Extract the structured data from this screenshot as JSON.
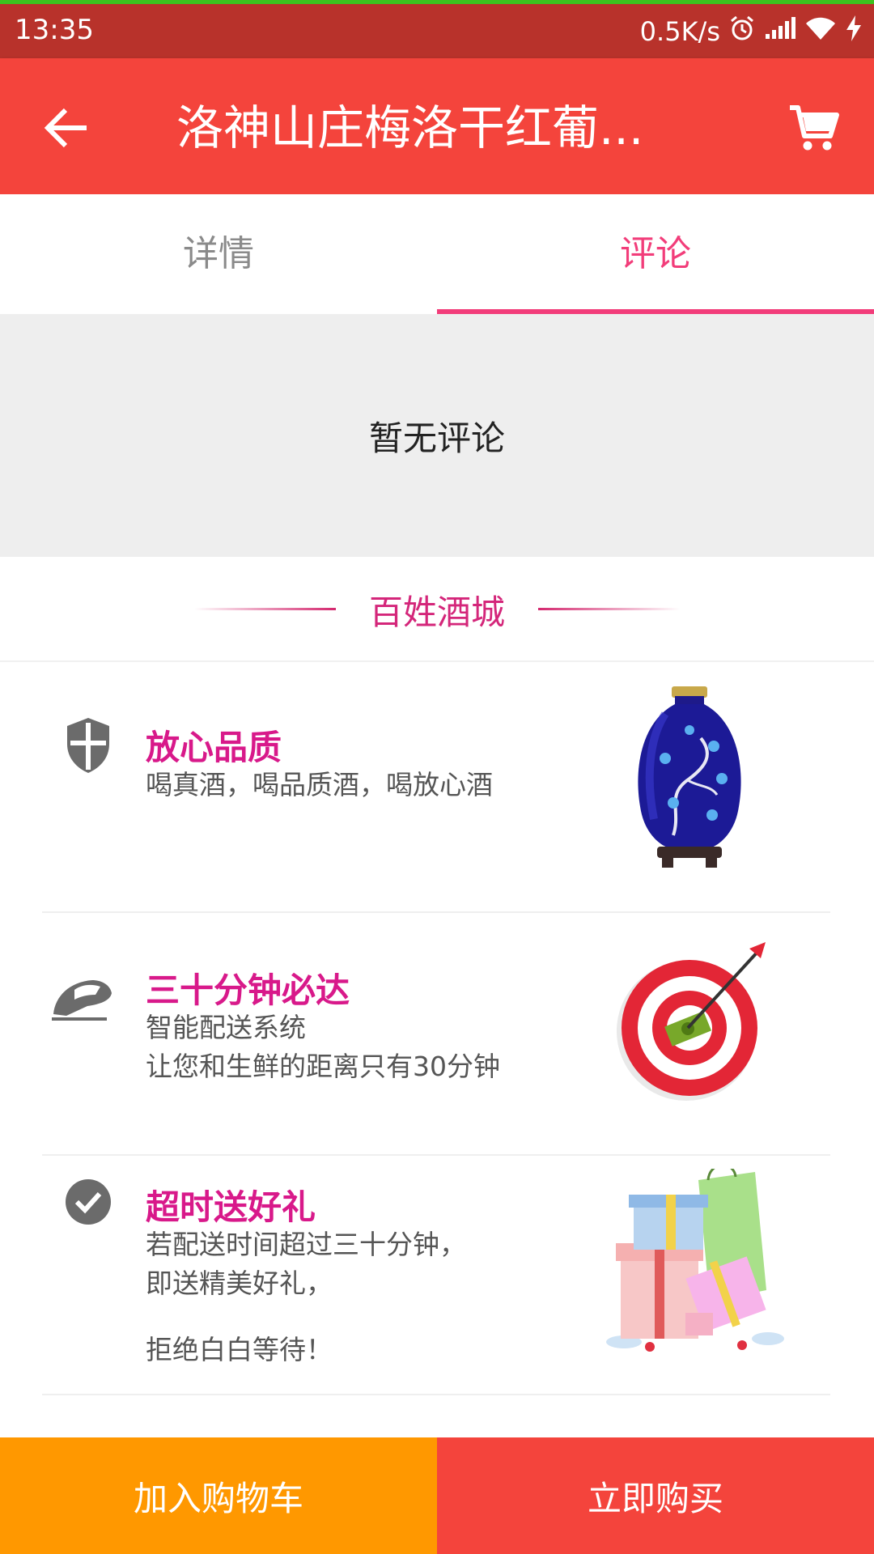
{
  "status_bar": {
    "time": "13:35",
    "net_speed": "0.5K/s",
    "icons": [
      "alarm-icon",
      "signal-icon",
      "wifi-icon",
      "charging-icon"
    ]
  },
  "app_bar": {
    "title": "洛神山庄梅洛干红葡...",
    "back_icon": "arrow-left-icon",
    "cart_icon": "shopping-cart-icon"
  },
  "tabs": [
    {
      "label": "详情",
      "active": false
    },
    {
      "label": "评论",
      "active": true
    }
  ],
  "comments": {
    "empty_text": "暂无评论"
  },
  "promo": {
    "title": "百姓酒城",
    "features": [
      {
        "icon": "shield-icon",
        "title": "放心品质",
        "desc": [
          "喝真酒，喝品质酒，喝放心酒"
        ],
        "image": "porcelain-vase-illustration"
      },
      {
        "icon": "bullet-train-icon",
        "title": "三十分钟必达",
        "desc": [
          "智能配送系统",
          "让您和生鲜的距离只有30分钟"
        ],
        "image": "target-dart-illustration"
      },
      {
        "icon": "check-circle-icon",
        "title": "超时送好礼",
        "desc": [
          "若配送时间超过三十分钟，",
          "即送精美好礼，",
          "拒绝白白等待！"
        ],
        "image": "gift-boxes-illustration"
      }
    ]
  },
  "bottom_bar": {
    "add_to_cart": "加入购物车",
    "buy_now": "立即购买"
  },
  "colors": {
    "status_bar": "#b8322b",
    "app_bar": "#f4443c",
    "accent_pink": "#f23d7a",
    "promo_pink": "#d8198a",
    "add_cart": "#ff9800",
    "buy_now": "#f4443c"
  }
}
